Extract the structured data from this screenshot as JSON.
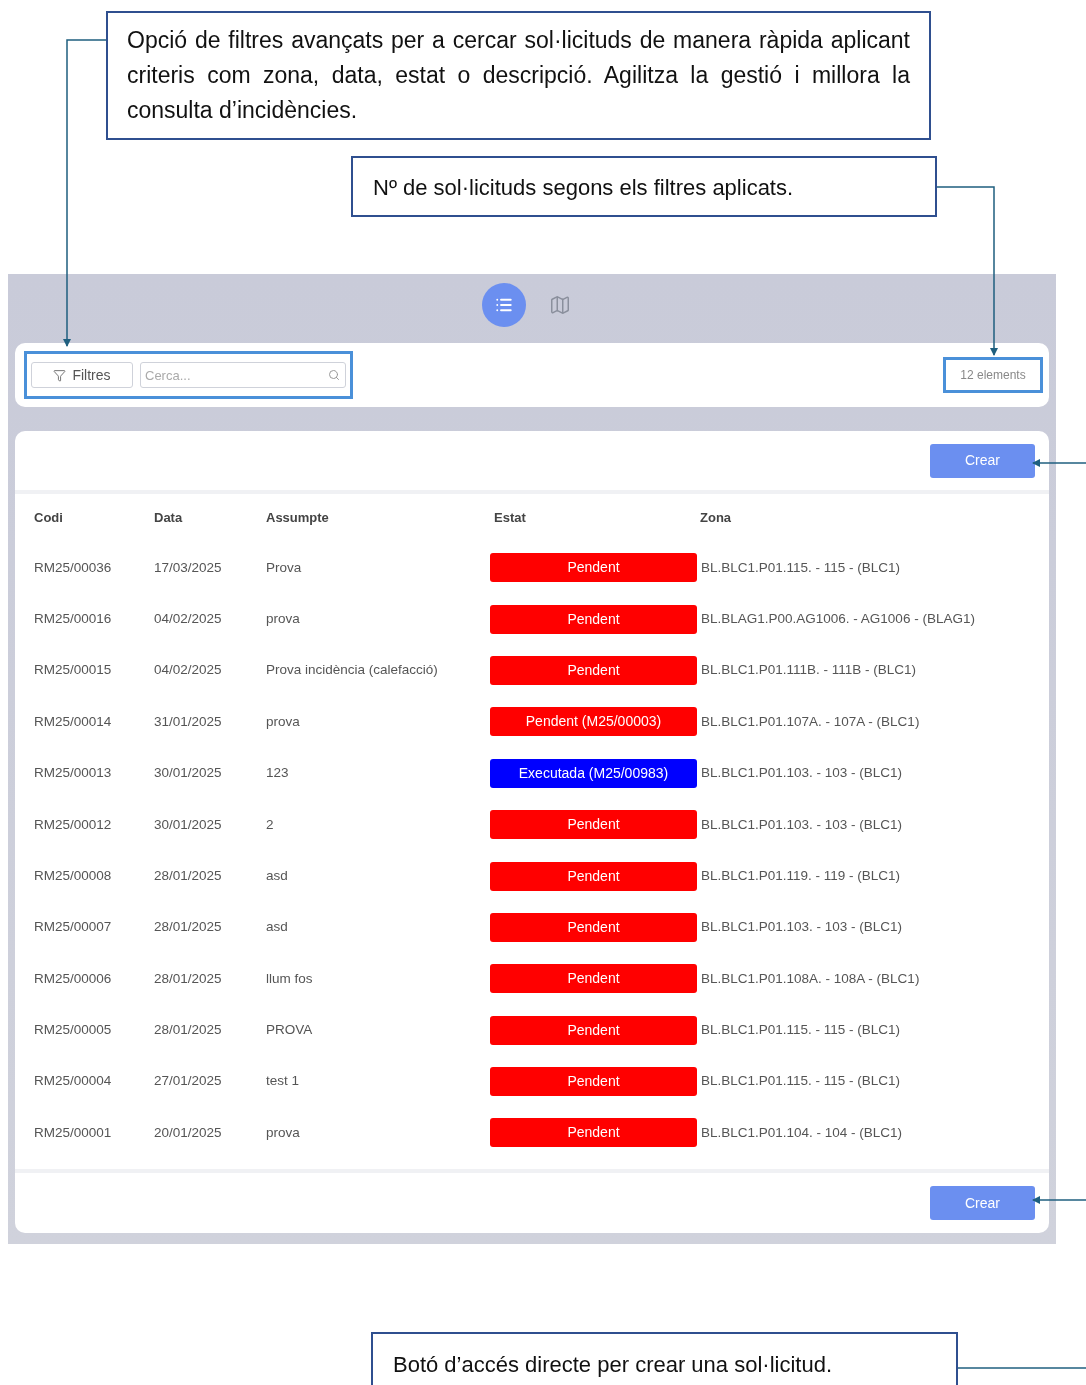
{
  "annotations": [
    {
      "text": "Opció de filtres avançats per a cercar sol·licituds de manera ràpida aplicant criteris com zona, data, estat o descripció. Agilitza la gestió i millora la consulta d’incidències."
    },
    {
      "text": "Nº de sol·licituds segons els filtres aplicats."
    },
    {
      "text": "Botó d’accés directe per crear una sol·licitud."
    }
  ],
  "view_toggle": [
    {
      "kind": "list",
      "selected": true
    },
    {
      "kind": "map",
      "selected": false
    }
  ],
  "toolbar": {
    "filters_button": "Filtres",
    "search": {
      "placeholder": "Cerca..."
    },
    "count": "12 elements"
  },
  "create_button_top": "Crear",
  "table": {
    "columns": [
      "Codi",
      "Data",
      "Assumpte",
      "Estat",
      "Zona"
    ],
    "rows": [
      {
        "code": "RM25/00036",
        "date": "17/03/2025",
        "subject": "Prova",
        "status": {
          "label": "Pendent",
          "color": "#ff0000"
        },
        "zone": "BL.BLC1.P01.115. - 115 - (BLC1)"
      },
      {
        "code": "RM25/00016",
        "date": "04/02/2025",
        "subject": "prova",
        "status": {
          "label": "Pendent",
          "color": "#ff0000"
        },
        "zone": "BL.BLAG1.P00.AG1006. - AG1006 - (BLAG1)"
      },
      {
        "code": "RM25/00015",
        "date": "04/02/2025",
        "subject": "Prova incidència (calefacció)",
        "status": {
          "label": "Pendent",
          "color": "#ff0000"
        },
        "zone": "BL.BLC1.P01.111B. - 111B - (BLC1)"
      },
      {
        "code": "RM25/00014",
        "date": "31/01/2025",
        "subject": "prova",
        "status": {
          "label": "Pendent (M25/00003)",
          "color": "#ff0000"
        },
        "zone": "BL.BLC1.P01.107A. - 107A - (BLC1)"
      },
      {
        "code": "RM25/00013",
        "date": "30/01/2025",
        "subject": "123",
        "status": {
          "label": "Executada (M25/00983)",
          "color": "#0000ff"
        },
        "zone": "BL.BLC1.P01.103. - 103 - (BLC1)"
      },
      {
        "code": "RM25/00012",
        "date": "30/01/2025",
        "subject": "2",
        "status": {
          "label": "Pendent",
          "color": "#ff0000"
        },
        "zone": "BL.BLC1.P01.103. - 103 - (BLC1)"
      },
      {
        "code": "RM25/00008",
        "date": "28/01/2025",
        "subject": "asd",
        "status": {
          "label": "Pendent",
          "color": "#ff0000"
        },
        "zone": "BL.BLC1.P01.119. - 119 - (BLC1)"
      },
      {
        "code": "RM25/00007",
        "date": "28/01/2025",
        "subject": "asd",
        "status": {
          "label": "Pendent",
          "color": "#ff0000"
        },
        "zone": "BL.BLC1.P01.103. - 103 - (BLC1)"
      },
      {
        "code": "RM25/00006",
        "date": "28/01/2025",
        "subject": "llum fos",
        "status": {
          "label": "Pendent",
          "color": "#ff0000"
        },
        "zone": "BL.BLC1.P01.108A. - 108A - (BLC1)"
      },
      {
        "code": "RM25/00005",
        "date": "28/01/2025",
        "subject": "PROVA",
        "status": {
          "label": "Pendent",
          "color": "#ff0000"
        },
        "zone": "BL.BLC1.P01.115. - 115 - (BLC1)"
      },
      {
        "code": "RM25/00004",
        "date": "27/01/2025",
        "subject": "test 1",
        "status": {
          "label": "Pendent",
          "color": "#ff0000"
        },
        "zone": "BL.BLC1.P01.115. - 115 - (BLC1)"
      },
      {
        "code": "RM25/00001",
        "date": "20/01/2025",
        "subject": "prova",
        "status": {
          "label": "Pendent",
          "color": "#ff0000"
        },
        "zone": "BL.BLC1.P01.104. - 104 - (BLC1)"
      }
    ]
  },
  "create_button_bottom": "Crear"
}
